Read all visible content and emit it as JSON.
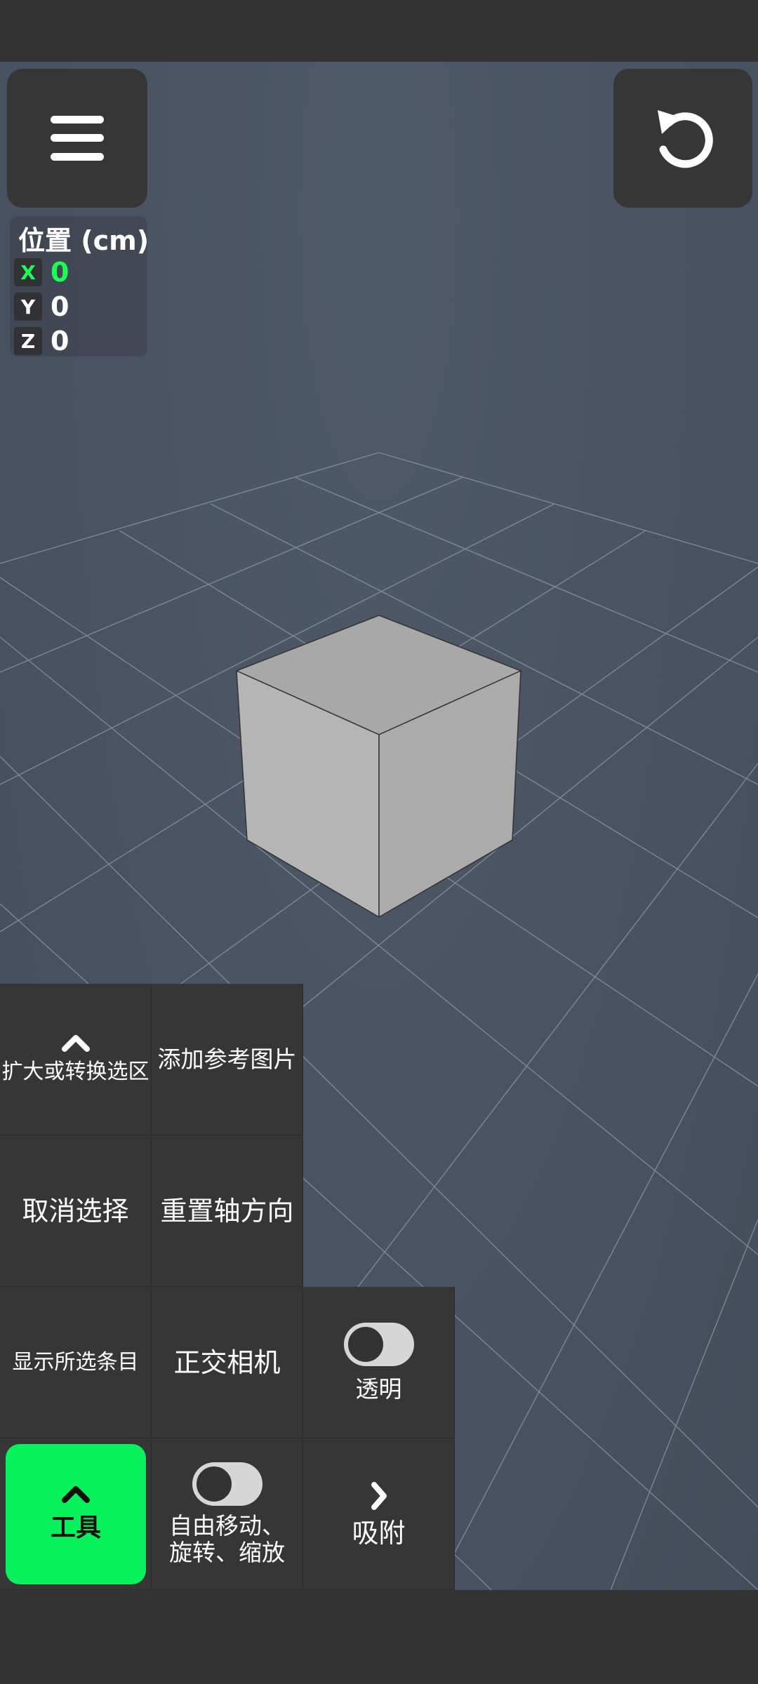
{
  "position_panel": {
    "title": "位置 (cm)",
    "axes": [
      {
        "axis": "X",
        "value": "0",
        "active": true
      },
      {
        "axis": "Y",
        "value": "0",
        "active": false
      },
      {
        "axis": "Z",
        "value": "0",
        "active": false
      }
    ]
  },
  "toolbar": {
    "expand_convert_selection": "扩大或转换选区",
    "add_reference_image": "添加参考图片",
    "deselect": "取消选择",
    "reset_axis_direction": "重置轴方向",
    "show_selected_items": "显示所选条目",
    "orthographic_camera": "正交相机",
    "transparent": "透明",
    "tools": "工具",
    "free_move_line1": "自由移动、",
    "free_move_line2": "旋转、缩放",
    "snap": "吸附"
  },
  "icons": {
    "menu": "hamburger-menu-icon",
    "undo": "undo-icon",
    "expand": "chevron-up-icon",
    "snap": "chevron-right-icon"
  },
  "colors": {
    "accent": "#08f25e",
    "active_axis": "#1bff55",
    "panel": "#363636",
    "viewport": "#4a5463",
    "cube": "#b3b3b3"
  }
}
